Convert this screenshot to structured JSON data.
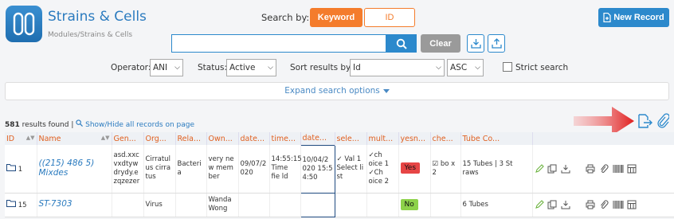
{
  "app": {
    "title": "Strains & Cells",
    "breadcrumb": "Modules/Strains & Cells"
  },
  "search": {
    "label": "Search by:",
    "keyword_label": "Keyword",
    "id_label": "ID",
    "input_value": "",
    "clear_label": "Clear"
  },
  "new_record_label": "New Record",
  "filters": {
    "operator_label": "Operator:",
    "operator_value": "ANI",
    "status_label": "Status:",
    "status_value": "Active",
    "sort_label": "Sort results by:",
    "sort_value": "Id",
    "order_value": "ASC",
    "strict_label": "Strict search"
  },
  "expand_label": "Expand search options",
  "results": {
    "count": "581",
    "found_text": " results found | ",
    "toggle_text": "Show/Hide all records on page"
  },
  "table": {
    "columns": [
      "ID",
      "Name",
      "Gen...",
      "Org...",
      "Rela...",
      "Own...",
      "date...",
      "time...",
      "date...",
      "sele...",
      "mult...",
      "yesn...",
      "che...",
      "Tube Co..."
    ],
    "rows": [
      {
        "id": "1",
        "name": "((215) 486 5) Mixdes",
        "gen": "asd.xxc vxdtyw drydy.e zqzezer",
        "org": "Cirratul us cirra tus",
        "rela": "Bacteri a",
        "own": "very ne w mem ber",
        "date": "09/07/2 020",
        "time": "14:55:15 Time fie ld",
        "datetime": "10/04/2 020 15:5 4:50",
        "select": "✓ Val 1 Select li st",
        "multi": "✓ch oice 1 ✓Ch oice 2",
        "yesno": "Yes",
        "check": "☑ bo x 2",
        "tube": "15 Tubes | 3 St raws"
      },
      {
        "id": "15",
        "name": "ST-7303",
        "gen": "",
        "org": "Virus",
        "rela": "",
        "own": "Wanda Wong",
        "date": "",
        "time": "",
        "datetime": "",
        "select": "",
        "multi": "",
        "yesno": "No",
        "check": "",
        "tube": "6 Tubes"
      }
    ]
  },
  "colors": {
    "brand_blue": "#2c89cc",
    "accent_orange": "#f47c2c",
    "yes_red": "#e64545",
    "no_green": "#8dd24a",
    "arrow_red": "#e01e1e"
  }
}
